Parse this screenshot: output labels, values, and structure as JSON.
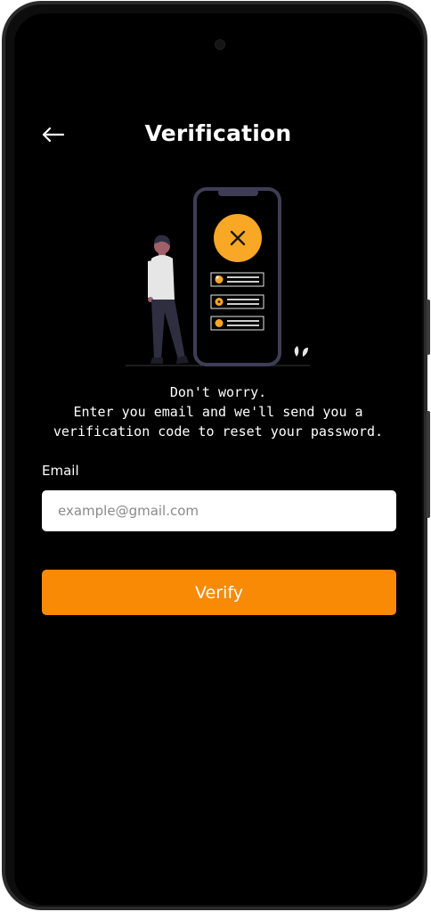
{
  "header": {
    "title": "Verification",
    "back_icon": "arrow-left-icon"
  },
  "illustration": {
    "phone_badge_icon": "close-icon",
    "accent_color": "#f9a825"
  },
  "message": {
    "line1": "Don't worry.",
    "line2": "Enter you email and we'll send you a",
    "line3": "verification code to reset your password."
  },
  "form": {
    "email_label": "Email",
    "email_value": "",
    "email_placeholder": "example@gmail.com",
    "verify_label": "Verify"
  },
  "colors": {
    "background": "#000000",
    "button": "#f88a06",
    "text": "#ffffff"
  }
}
